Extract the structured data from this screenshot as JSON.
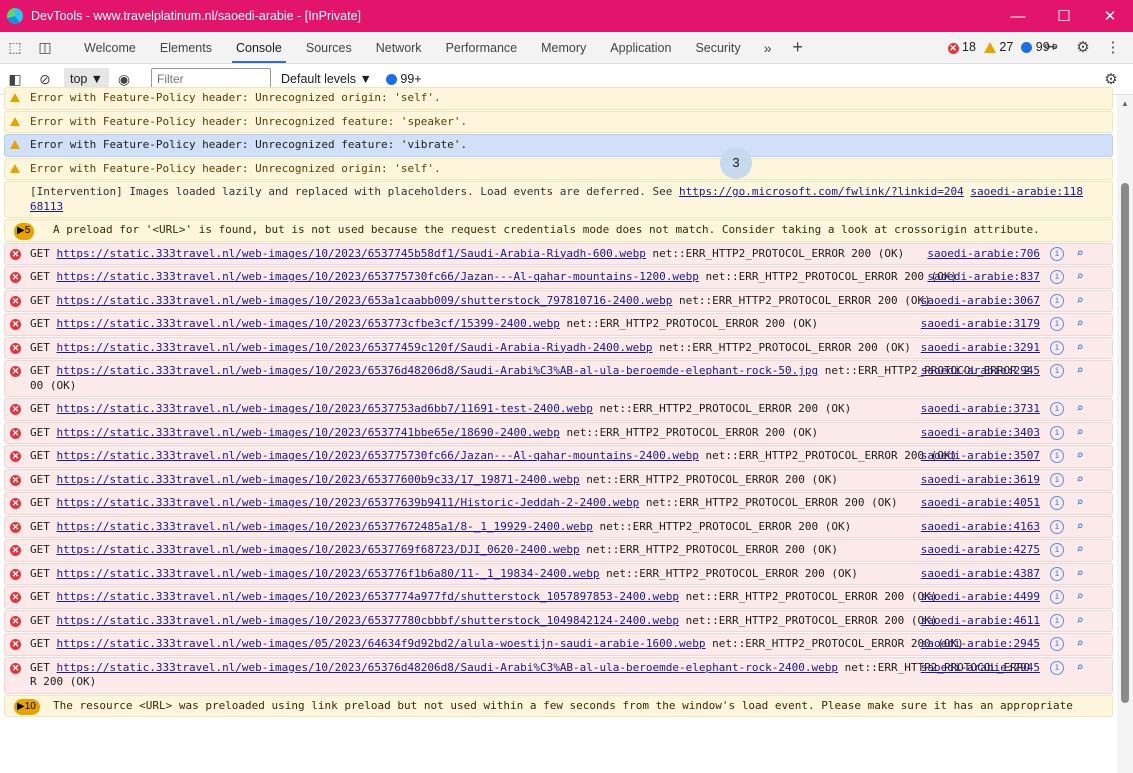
{
  "window": {
    "title": "DevTools - www.travelplatinum.nl/saoedi-arabie - [InPrivate]"
  },
  "tabs": [
    "Welcome",
    "Elements",
    "Console",
    "Sources",
    "Network",
    "Performance",
    "Memory",
    "Application",
    "Security"
  ],
  "counts": {
    "errors": "18",
    "warnings": "27",
    "info": "99+"
  },
  "console_bar": {
    "context": "top",
    "filter_placeholder": "Filter",
    "levels": "Default levels",
    "info_count": "99+"
  },
  "bubble": "3",
  "messages": [
    {
      "kind": "warn",
      "text": "Error with Feature-Policy header: Unrecognized origin: 'self'."
    },
    {
      "kind": "warn",
      "text": "Error with Feature-Policy header: Unrecognized feature: 'speaker'."
    },
    {
      "kind": "sel",
      "text": "Error with Feature-Policy header: Unrecognized feature: 'vibrate'."
    },
    {
      "kind": "warn",
      "text": "Error with Feature-Policy header: Unrecognized origin: 'self'."
    },
    {
      "kind": "intervention",
      "text": "[Intervention] Images loaded lazily and replaced with placeholders. Load events are deferred. See ",
      "link": "https://go.microsoft.com/fwlink/?linkid=204",
      "src": "saoedi-arabie:11868113"
    },
    {
      "kind": "count",
      "count": "5",
      "text": "A preload for '<URL>' is found, but is not used because the request credentials mode does not match. Consider taking a look at crossorigin attribute."
    },
    {
      "kind": "err",
      "url": "https://static.333travel.nl/web-images/10/2023/6537745b58df1/Saudi-Arabia-Riyadh-600.webp",
      "tail": " net::ERR_HTTP2_PROTOCOL_ERROR 200 (OK)",
      "src": "saoedi-arabie:706"
    },
    {
      "kind": "err",
      "url": "https://static.333travel.nl/web-images/10/2023/653775730fc66/Jazan---Al-qahar-mountains-1200.webp",
      "tail": " net::ERR_HTTP2_PROTOCOL_ERROR 200 (OK)",
      "src": "saoedi-arabie:837"
    },
    {
      "kind": "err",
      "url": "https://static.333travel.nl/web-images/10/2023/653a1caabb009/shutterstock_797810716-2400.webp",
      "tail": " net::ERR_HTTP2_PROTOCOL_ERROR 200 (OK)",
      "src": "saoedi-arabie:3067"
    },
    {
      "kind": "err",
      "url": "https://static.333travel.nl/web-images/10/2023/653773cfbe3cf/15399-2400.webp",
      "tail": " net::ERR_HTTP2_PROTOCOL_ERROR 200 (OK)",
      "src": "saoedi-arabie:3179"
    },
    {
      "kind": "err",
      "url": "https://static.333travel.nl/web-images/10/2023/65377459c120f/Saudi-Arabia-Riyadh-2400.webp",
      "tail": " net::ERR_HTTP2_PROTOCOL_ERROR 200 (OK)",
      "src": "saoedi-arabie:3291"
    },
    {
      "kind": "err",
      "url": "https://static.333travel.nl/web-images/10/2023/65376d48206d8/Saudi-Arabi%C3%AB-al-ula-beroemde-elephant-rock-50.jpg",
      "tail": " net::ERR_HTTP2_PROTOCOL_ERROR 200 (OK)",
      "src": "saoedi-arabie:2945"
    },
    {
      "kind": "err",
      "url": "https://static.333travel.nl/web-images/10/2023/6537753ad6bb7/11691-test-2400.webp",
      "tail": " net::ERR_HTTP2_PROTOCOL_ERROR 200 (OK)",
      "src": "saoedi-arabie:3731"
    },
    {
      "kind": "err",
      "url": "https://static.333travel.nl/web-images/10/2023/6537741bbe65e/18690-2400.webp",
      "tail": " net::ERR_HTTP2_PROTOCOL_ERROR 200 (OK)",
      "src": "saoedi-arabie:3403"
    },
    {
      "kind": "err",
      "url": "https://static.333travel.nl/web-images/10/2023/653775730fc66/Jazan---Al-qahar-mountains-2400.webp",
      "tail": " net::ERR_HTTP2_PROTOCOL_ERROR 200 (OK)",
      "src": "saoedi-arabie:3507"
    },
    {
      "kind": "err",
      "url": "https://static.333travel.nl/web-images/10/2023/65377600b9c33/17_19871-2400.webp",
      "tail": " net::ERR_HTTP2_PROTOCOL_ERROR 200 (OK)",
      "src": "saoedi-arabie:3619"
    },
    {
      "kind": "err",
      "url": "https://static.333travel.nl/web-images/10/2023/65377639b9411/Historic-Jeddah-2-2400.webp",
      "tail": " net::ERR_HTTP2_PROTOCOL_ERROR 200 (OK)",
      "src": "saoedi-arabie:4051"
    },
    {
      "kind": "err",
      "url": "https://static.333travel.nl/web-images/10/2023/65377672485a1/8-_1_19929-2400.webp",
      "tail": " net::ERR_HTTP2_PROTOCOL_ERROR 200 (OK)",
      "src": "saoedi-arabie:4163"
    },
    {
      "kind": "err",
      "url": "https://static.333travel.nl/web-images/10/2023/6537769f68723/DJI_0620-2400.webp",
      "tail": " net::ERR_HTTP2_PROTOCOL_ERROR 200 (OK)",
      "src": "saoedi-arabie:4275"
    },
    {
      "kind": "err",
      "url": "https://static.333travel.nl/web-images/10/2023/653776f1b6a80/11-_1_19834-2400.webp",
      "tail": " net::ERR_HTTP2_PROTOCOL_ERROR 200 (OK)",
      "src": "saoedi-arabie:4387"
    },
    {
      "kind": "err",
      "url": "https://static.333travel.nl/web-images/10/2023/6537774a977fd/shutterstock_1057897853-2400.webp",
      "tail": " net::ERR_HTTP2_PROTOCOL_ERROR 200 (OK)",
      "src": "saoedi-arabie:4499"
    },
    {
      "kind": "err",
      "url": "https://static.333travel.nl/web-images/10/2023/65377780cbbbf/shutterstock_1049842124-2400.webp",
      "tail": " net::ERR_HTTP2_PROTOCOL_ERROR 200 (OK)",
      "src": "saoedi-arabie:4611"
    },
    {
      "kind": "err",
      "url": "https://static.333travel.nl/web-images/05/2023/64634f9d92bd2/alula-woestijn-saudi-arabie-1600.webp",
      "tail": " net::ERR_HTTP2_PROTOCOL_ERROR 200 (OK)",
      "src": "saoedi-arabie:2945"
    },
    {
      "kind": "err",
      "url": "https://static.333travel.nl/web-images/10/2023/65376d48206d8/Saudi-Arabi%C3%AB-al-ula-beroemde-elephant-rock-2400.webp",
      "tail": " net::ERR_HTTP2_PROTOCOL_ERROR 200 (OK)",
      "src": "saoedi-arabie:2945"
    },
    {
      "kind": "count",
      "count": "10",
      "text": "The resource <URL> was preloaded using link preload but not used within a few seconds from the window's load event. Please make sure it has an appropriate"
    }
  ]
}
